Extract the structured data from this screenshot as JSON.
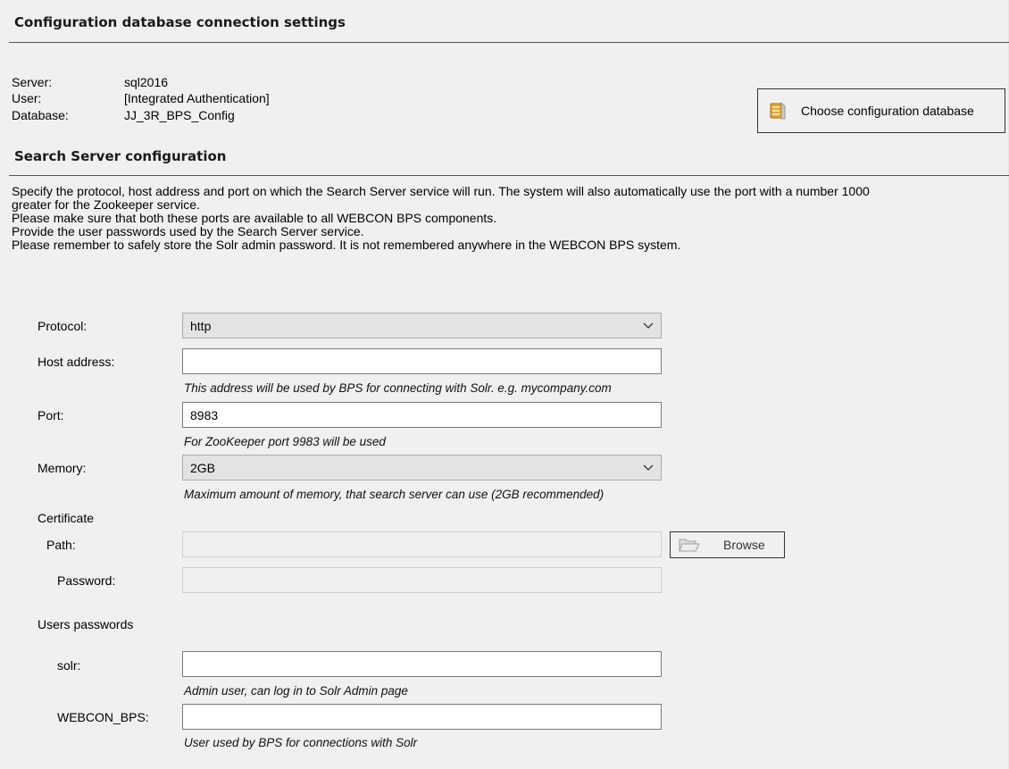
{
  "config_db": {
    "title": "Configuration database connection settings",
    "server_label": "Server:",
    "server_value": "sql2016",
    "user_label": "User:",
    "user_value": "[Integrated Authentication]",
    "database_label": "Database:",
    "database_value": "JJ_3R_BPS_Config",
    "choose_button_label": "Choose configuration database"
  },
  "search_server": {
    "title": "Search Server configuration",
    "description": [
      "Specify the protocol, host address and port on which the Search Server service will run. The system will also automatically use the port with a number 1000",
      "greater for the Zookeeper service.",
      "Please make sure that both these ports are available to all WEBCON BPS components.",
      "Provide the user passwords used by the Search Server service.",
      "Please remember to safely store the Solr admin password. It is not remembered anywhere in the WEBCON BPS system."
    ]
  },
  "form": {
    "protocol_label": "Protocol:",
    "protocol_value": "http",
    "host_label": "Host address:",
    "host_value": "",
    "host_hint": "This address will be used by BPS for connecting with Solr. e.g. mycompany.com",
    "port_label": "Port:",
    "port_value": "8983",
    "port_hint": "For ZooKeeper port 9983 will be used",
    "memory_label": "Memory:",
    "memory_value": "2GB",
    "memory_hint": "Maximum amount of memory, that search server can use (2GB recommended)",
    "certificate_label": "Certificate",
    "path_label": "Path:",
    "path_value": "",
    "browse_label": "Browse",
    "password_label": "Password:",
    "password_value": "",
    "users_passwords_label": "Users passwords",
    "solr_label": "solr:",
    "solr_value": "",
    "solr_hint": "Admin user, can log in to Solr Admin page",
    "webcon_label": "WEBCON_BPS:",
    "webcon_value": "",
    "webcon_hint": "User used by BPS for connections with Solr"
  },
  "icons": {
    "database": "database-icon",
    "folder": "folder-open-icon",
    "chevron": "chevron-down-icon"
  }
}
